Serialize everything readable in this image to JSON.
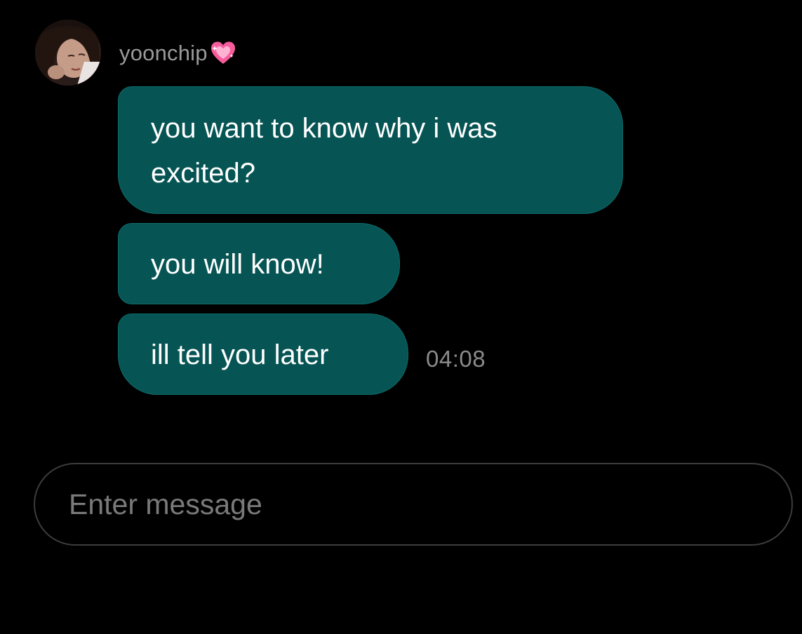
{
  "contact": {
    "username": "yoonchip",
    "username_icon": "pink-sparkling-heart-icon"
  },
  "messages": [
    {
      "text": "you want to know why i was excited?"
    },
    {
      "text": "you will know!"
    },
    {
      "text": "ill tell you later"
    }
  ],
  "last_message_time": "04:08",
  "composer": {
    "placeholder": "Enter message",
    "value": ""
  },
  "colors": {
    "background": "#000000",
    "bubble": "#075454",
    "username": "#9a9a9a",
    "timestamp": "#8a8a8a",
    "heart": "#f75c9c"
  }
}
